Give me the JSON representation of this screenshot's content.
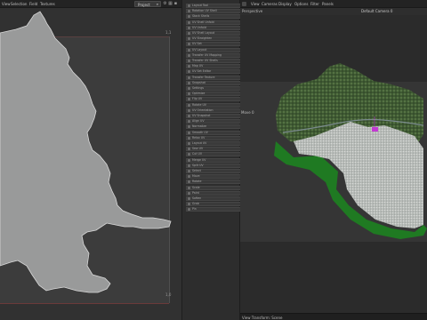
{
  "uv_editor": {
    "menu": [
      "View",
      "Selection",
      "Field",
      "Textures"
    ],
    "project_select": "Project",
    "coords": {
      "top_right": "1,1",
      "bottom_right": "1,0"
    }
  },
  "tool_panel": {
    "items": [
      {
        "label": "Layout Tool"
      },
      {
        "label": "Rotation UV Shell"
      },
      {
        "label": "Stack Shells"
      },
      {
        "label": "UV Shell Unfold"
      },
      {
        "label": "UV Unfold"
      },
      {
        "label": "UV Shell Layout"
      },
      {
        "label": "UV Straighten"
      },
      {
        "label": "UV Set"
      },
      {
        "label": "UV Layout"
      },
      {
        "label": "Transfer UV Mapping"
      },
      {
        "label": "Transfer UV Shells"
      },
      {
        "label": "Map UV"
      },
      {
        "label": "UV Set Editor"
      },
      {
        "label": "Transfer Texture"
      },
      {
        "label": "Snapshot"
      },
      {
        "label": "Settings"
      },
      {
        "label": "Optimize"
      },
      {
        "label": "Flip UV"
      },
      {
        "label": "Rotate UV"
      },
      {
        "label": "UV Orientation"
      },
      {
        "label": "UV Snapshot"
      },
      {
        "label": "Align UV"
      },
      {
        "label": "Normalize"
      },
      {
        "label": "Smooth UV"
      },
      {
        "label": "Relax UV"
      },
      {
        "label": "Layout UV"
      },
      {
        "label": "Sew UV"
      },
      {
        "label": "Cut UV"
      },
      {
        "label": "Merge UV"
      },
      {
        "label": "Split UV"
      },
      {
        "label": "Select"
      },
      {
        "label": "Move"
      },
      {
        "label": "Rotate"
      },
      {
        "label": "Scale"
      },
      {
        "label": "Paint"
      },
      {
        "label": "Soften"
      },
      {
        "label": "Grab"
      },
      {
        "label": "Pin"
      }
    ]
  },
  "view3d": {
    "menu": [
      "View",
      "Cameras",
      "Display",
      "Options",
      "Filter",
      "Panels"
    ],
    "perspective_label": "Perspective",
    "camera_label": "Default Camera 0",
    "side_label": "Move 0",
    "status_text": "View Transform: Scene",
    "colors": {
      "terrain_green": "#4b6b3a",
      "urban": "#bfc3c0",
      "highlight": "#c23ad1"
    }
  }
}
